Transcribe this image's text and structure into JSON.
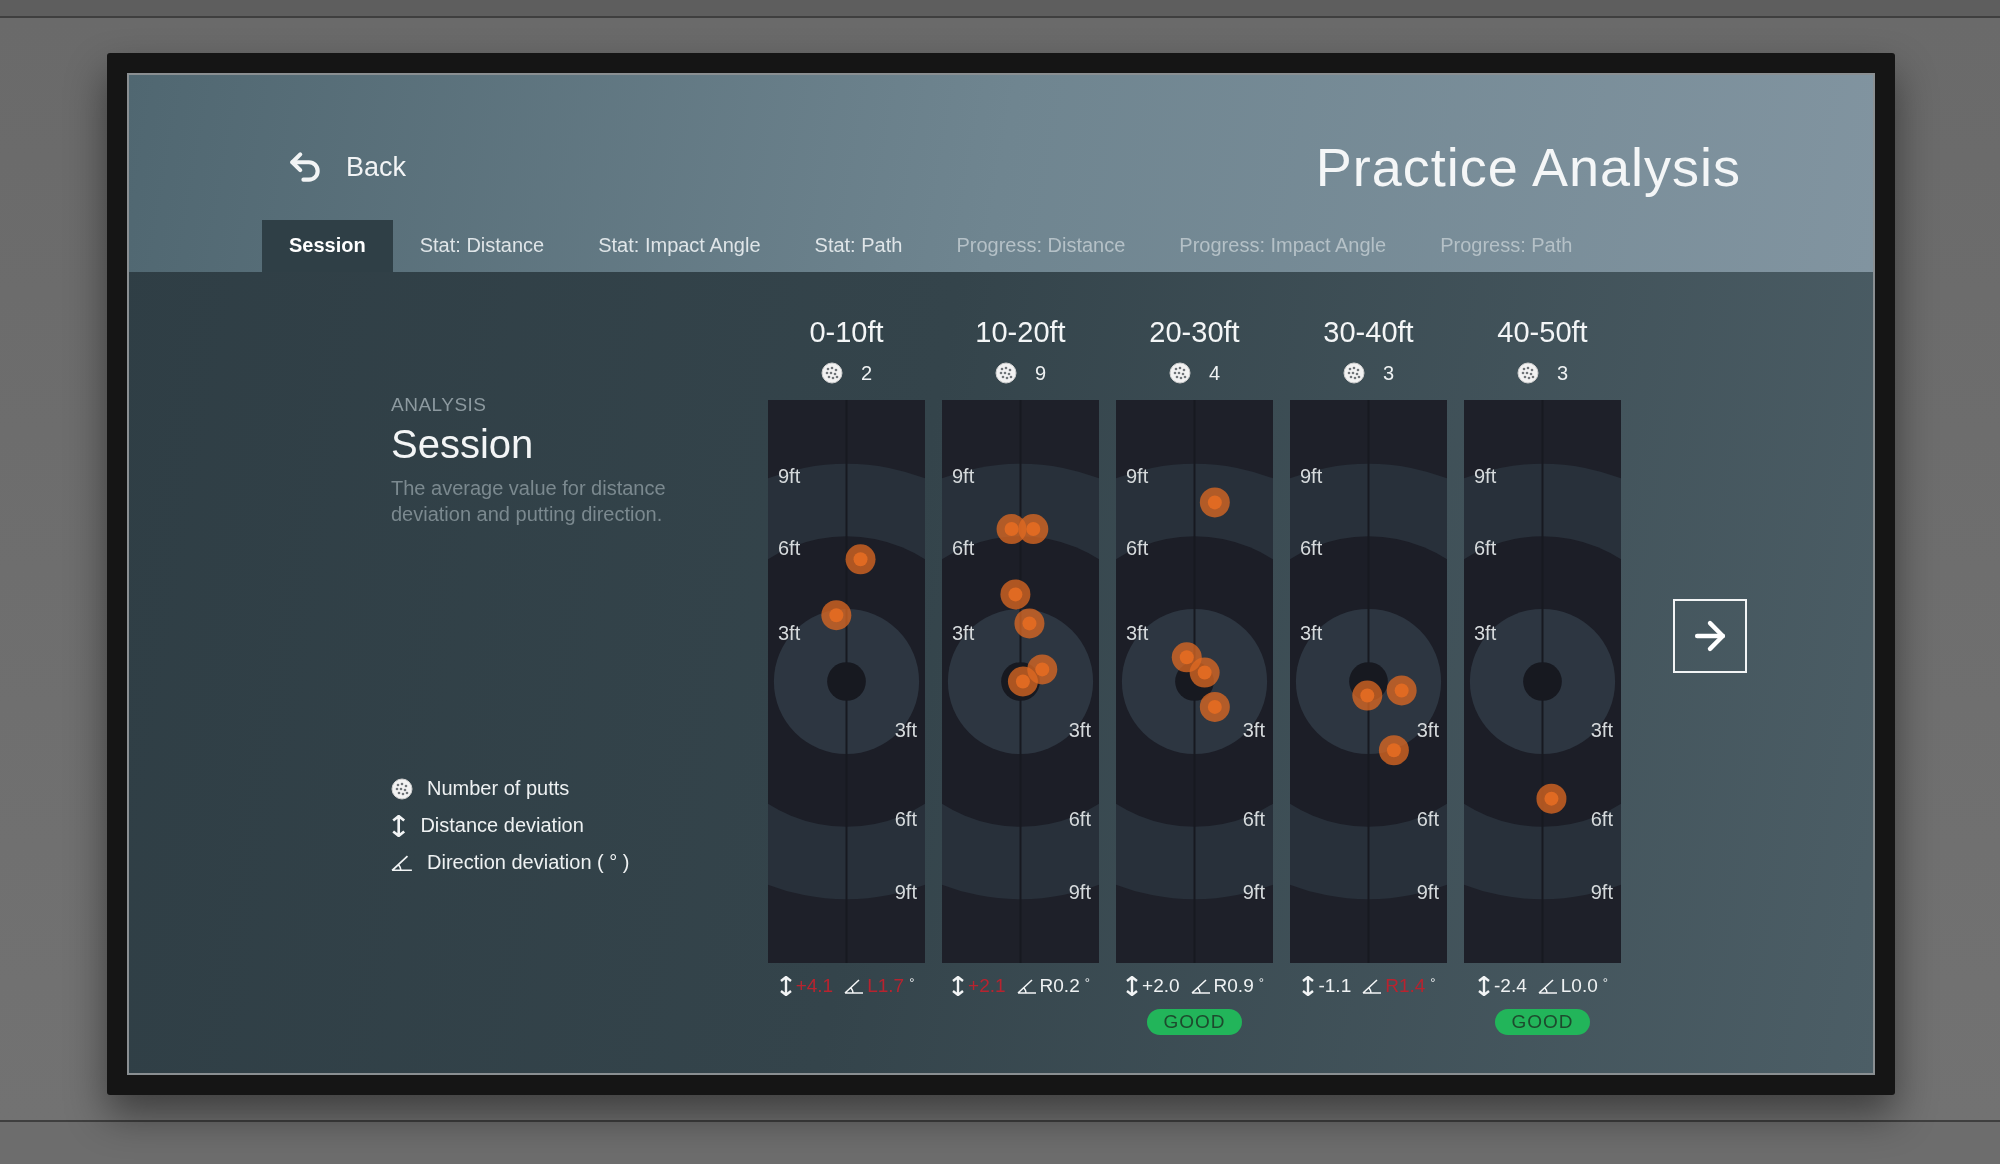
{
  "header": {
    "back": "Back",
    "title": "Practice Analysis"
  },
  "tabs": [
    {
      "label": "Session",
      "selected": true,
      "disabled": false
    },
    {
      "label": "Stat: Distance",
      "selected": false,
      "disabled": false
    },
    {
      "label": "Stat: Impact Angle",
      "selected": false,
      "disabled": false
    },
    {
      "label": "Stat: Path",
      "selected": false,
      "disabled": false
    },
    {
      "label": "Progress: Distance",
      "selected": false,
      "disabled": true
    },
    {
      "label": "Progress: Impact Angle",
      "selected": false,
      "disabled": true
    },
    {
      "label": "Progress: Path",
      "selected": false,
      "disabled": true
    }
  ],
  "intro": {
    "eyebrow": "ANALYSIS",
    "title": "Session",
    "description": "The average value for distance deviation and putting direction."
  },
  "legend": [
    {
      "kind": "putts",
      "label": "Number of putts"
    },
    {
      "kind": "distance",
      "label": "Distance deviation"
    },
    {
      "kind": "direction",
      "label": "Direction deviation ( ° )"
    }
  ],
  "ranges": [
    {
      "title": "0-10ft",
      "putts": "2",
      "marks": [
        "9ft",
        "6ft",
        "3ft",
        "3ft",
        "6ft",
        "9ft"
      ],
      "distance": {
        "value": "+4.1",
        "warn": true
      },
      "direction": {
        "value": "L1.7",
        "unit": "°",
        "warn": true
      }
    },
    {
      "title": "10-20ft",
      "putts": "9",
      "marks": [
        "9ft",
        "6ft",
        "3ft",
        "3ft",
        "6ft",
        "9ft"
      ],
      "distance": {
        "value": "+2.1",
        "warn": true
      },
      "direction": {
        "value": "R0.2",
        "unit": "°",
        "warn": false
      }
    },
    {
      "title": "20-30ft",
      "putts": "4",
      "marks": [
        "9ft",
        "6ft",
        "3ft",
        "3ft",
        "6ft",
        "9ft"
      ],
      "distance": {
        "value": "+2.0",
        "warn": false
      },
      "direction": {
        "value": "R0.9",
        "unit": "°",
        "warn": false
      },
      "badge": "GOOD"
    },
    {
      "title": "30-40ft",
      "putts": "3",
      "marks": [
        "9ft",
        "6ft",
        "3ft",
        "3ft",
        "6ft",
        "9ft"
      ],
      "distance": {
        "value": "-1.1",
        "warn": false
      },
      "direction": {
        "value": "R1.4",
        "unit": "°",
        "warn": true
      }
    },
    {
      "title": "40-50ft",
      "putts": "3",
      "marks": [
        "9ft",
        "6ft",
        "3ft",
        "3ft",
        "6ft",
        "9ft"
      ],
      "distance": {
        "value": "-2.4",
        "warn": false
      },
      "direction": {
        "value": "L0.0",
        "unit": "°",
        "warn": false
      },
      "badge": "GOOD"
    }
  ]
}
